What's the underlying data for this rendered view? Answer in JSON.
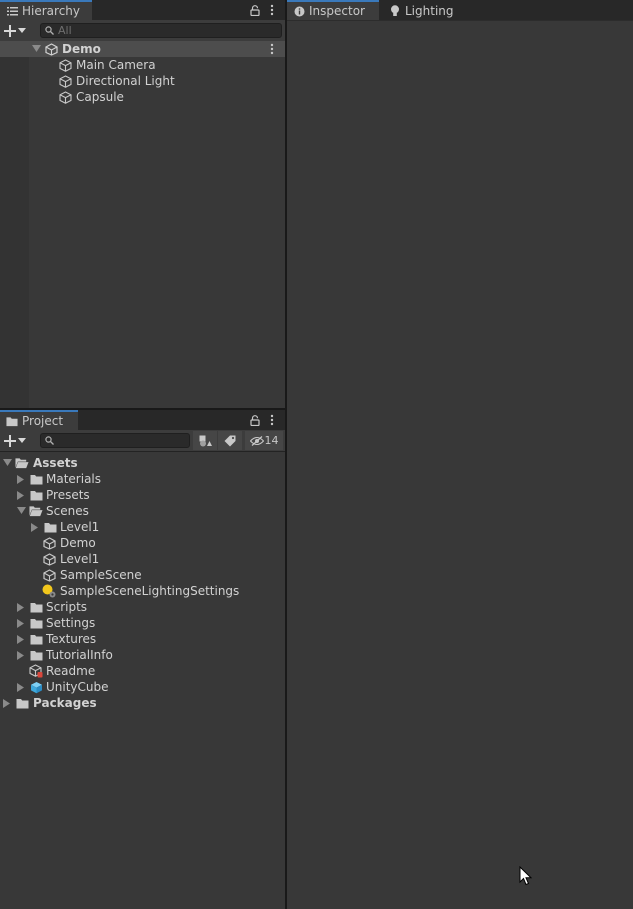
{
  "hierarchy": {
    "tab_label": "Hierarchy",
    "search_placeholder": "All",
    "scene_name": "Demo",
    "objects": [
      {
        "label": "Main Camera"
      },
      {
        "label": "Directional Light"
      },
      {
        "label": "Capsule"
      }
    ]
  },
  "inspector": {
    "tabs": [
      {
        "label": "Inspector",
        "active": true
      },
      {
        "label": "Lighting",
        "active": false
      }
    ]
  },
  "project": {
    "tab_label": "Project",
    "search_placeholder": "",
    "hidden_count": "14",
    "tree": {
      "assets": "Assets",
      "materials": "Materials",
      "presets": "Presets",
      "scenes": "Scenes",
      "level1_folder": "Level1",
      "demo_scene": "Demo",
      "level1_scene": "Level1",
      "sample_scene": "SampleScene",
      "lighting_settings": "SampleSceneLightingSettings",
      "scripts": "Scripts",
      "settings": "Settings",
      "textures": "Textures",
      "tutorial_info": "TutorialInfo",
      "readme": "Readme",
      "unity_cube": "UnityCube",
      "packages": "Packages"
    }
  },
  "colors": {
    "panel_bg": "#383838",
    "tab_bar_bg": "#282828",
    "active_tab_accent": "#3a79bb",
    "selection_bg": "#4d4d4d",
    "text": "#d2d2d2"
  }
}
